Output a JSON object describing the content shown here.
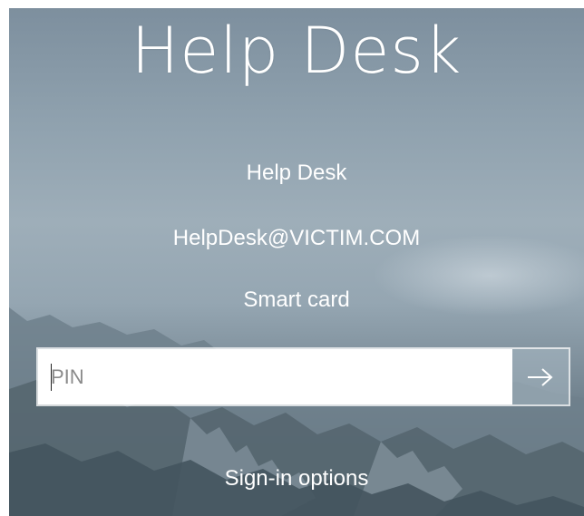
{
  "lock_screen": {
    "title": "Help Desk",
    "account": {
      "display_name": "Help Desk",
      "email": "HelpDesk@VICTIM.COM",
      "sign_in_method": "Smart card"
    },
    "pin_field": {
      "placeholder": "PIN",
      "value": ""
    },
    "submit_icon": "arrow-right-icon",
    "sign_in_options_label": "Sign-in options"
  }
}
